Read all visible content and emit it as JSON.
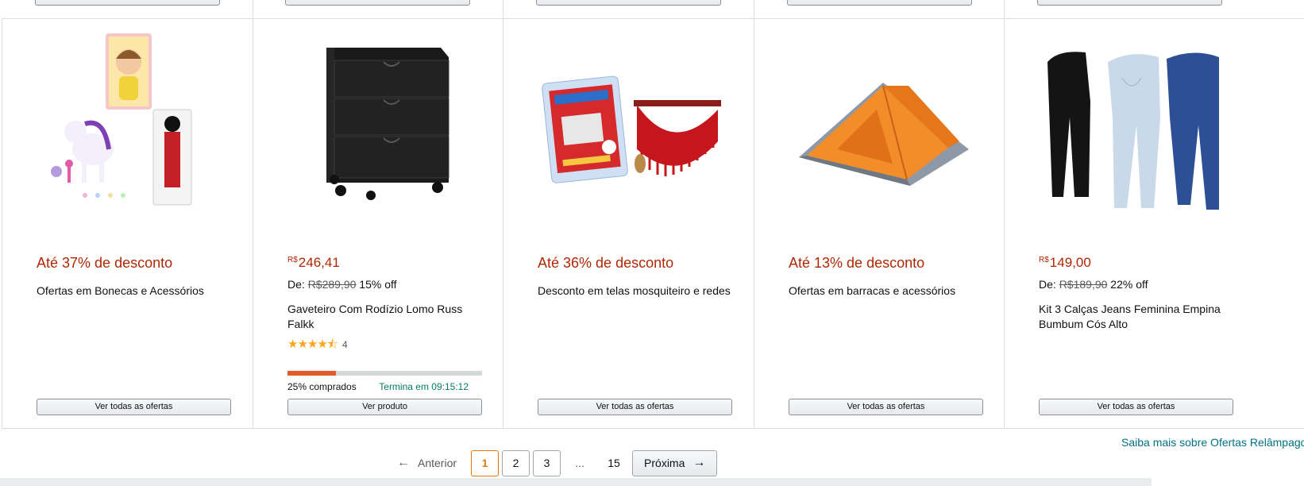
{
  "cards": [
    {
      "type": "deal",
      "discount": "Até 37% de desconto",
      "title": "Ofertas em Bonecas e Acessórios",
      "image": "dolls-and-toys",
      "button": "Ver todas as ofertas"
    },
    {
      "type": "product",
      "price_currency": "R$",
      "price_value": "246,41",
      "was_prefix": "De:",
      "was_price": "R$289,90",
      "off": "15% off",
      "title": "Gaveteiro Com Rodízio Lomo Russ Falkk",
      "rating": 4.5,
      "rating_count": "4",
      "claimed_pct": 25,
      "claimed_label": "25% comprados",
      "ends_label": "Termina em 09:15:12",
      "image": "black-drawer-cabinet",
      "button": "Ver produto"
    },
    {
      "type": "deal",
      "discount": "Até 36% de desconto",
      "title": "Desconto em telas mosquiteiro e redes",
      "image": "mosquito-net-and-hammock",
      "button": "Ver todas as ofertas"
    },
    {
      "type": "deal",
      "discount": "Até 13% de desconto",
      "title": "Ofertas em barracas e acessórios",
      "image": "orange-tent",
      "button": "Ver todas as ofertas"
    },
    {
      "type": "product",
      "price_currency": "R$",
      "price_value": "149,00",
      "was_prefix": "De:",
      "was_price": "R$189,90",
      "off": "22% off",
      "title": "Kit 3 Calças Jeans Feminina Empina Bumbum Cós Alto",
      "image": "three-jeans",
      "button": "Ver todas as ofertas"
    }
  ],
  "learn_more": "Saiba mais sobre Ofertas Relâmpago",
  "pagination": {
    "prev": "Anterior",
    "pages": [
      "1",
      "2",
      "3"
    ],
    "current": "1",
    "ellipsis": "...",
    "last": "15",
    "next": "Próxima"
  },
  "colors": {
    "deal_red": "#b12704",
    "link_teal": "#007185",
    "progress_fill": "#e15b2b",
    "ends_green": "#067d62",
    "pager_active": "#e47911"
  }
}
